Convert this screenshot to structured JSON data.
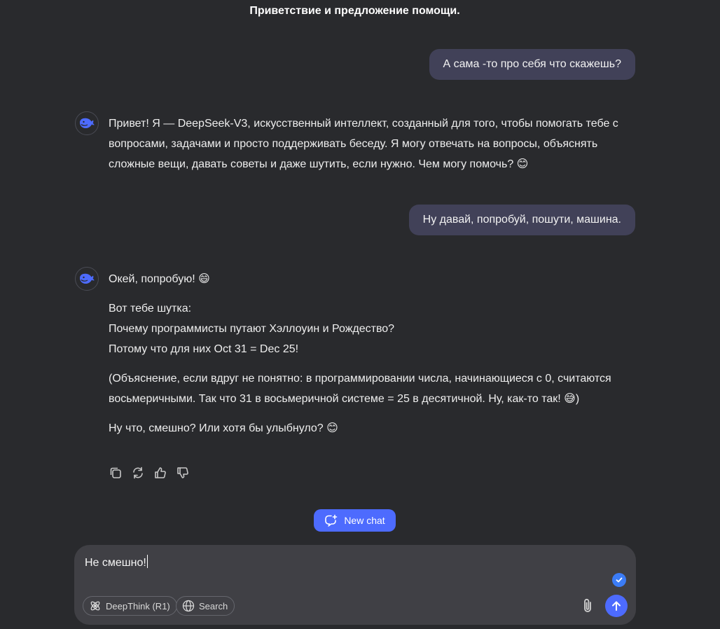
{
  "header": {
    "title": "Приветствие и предложение помощи."
  },
  "conversation": {
    "user_1": "А сама -то про себя что скажешь?",
    "assistant_1": "Привет! Я — DeepSeek-V3, искусственный интеллект, созданный для того, чтобы помогать тебе с вопросами, задачами и просто поддерживать беседу. Я могу отвечать на вопросы, объяснять сложные вещи, давать советы и даже шутить, если нужно. Чем могу помочь? 😊",
    "user_2": "Ну давай, попробуй, пошути, машина.",
    "assistant_2": {
      "p1": "Окей, попробую! 😄",
      "p2_line1": "Вот тебе шутка:",
      "p2_line2": "Почему программисты путают Хэллоуин и Рождество?",
      "p2_line3": "Потому что для них Oct 31 = Dec 25!",
      "p3": "(Объяснение, если вдруг не понятно: в программировании числа, начинающиеся с 0, считаются восьмеричными. Так что 31 в восьмеричной системе = 25 в десятичной. Ну, как-то так! 😅)",
      "p4": "Ну что, смешно? Или хотя бы улыбнуло? 😊"
    }
  },
  "message_actions": {
    "icons": [
      "copy-icon",
      "regenerate-icon",
      "thumbs-up-icon",
      "thumbs-down-icon"
    ]
  },
  "new_chat": {
    "label": "New chat",
    "icon": "new-chat-icon"
  },
  "composer": {
    "input_value": "Не смешно!",
    "deepthink_label": "DeepThink (R1)",
    "search_label": "Search"
  },
  "colors": {
    "background": "#292a2d",
    "user_bubble": "#414158",
    "accent": "#4d6bfe",
    "composer": "#404045"
  }
}
